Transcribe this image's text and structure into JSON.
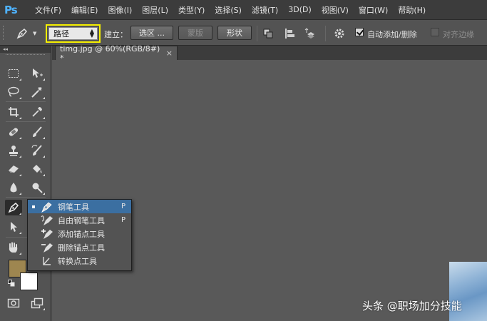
{
  "app": {
    "logo": "Ps"
  },
  "menubar": {
    "items": [
      "文件(F)",
      "编辑(E)",
      "图像(I)",
      "图层(L)",
      "类型(Y)",
      "选择(S)",
      "滤镜(T)",
      "3D(D)",
      "视图(V)",
      "窗口(W)",
      "帮助(H)"
    ]
  },
  "options": {
    "mode_value": "路径",
    "make_label": "建立：",
    "selection_button": "选区 ...",
    "mask_button": "蒙版",
    "shape_button": "形状",
    "auto_add_delete_label": "自动添加/删除",
    "auto_add_delete_checked": true,
    "align_edges_label": "对齐边缘",
    "align_edges_checked": false
  },
  "toolbar": {
    "collapse_arrows": "◂◂",
    "foreground_color": "#9e8650",
    "background_color": "#ffffff"
  },
  "document": {
    "tab_title": "timg.jpg @ 60%(RGB/8#) *",
    "close_glyph": "×"
  },
  "flyout": {
    "items": [
      {
        "label": "钢笔工具",
        "key": "P",
        "icon": "pen-icon",
        "selected": true
      },
      {
        "label": "自由钢笔工具",
        "key": "P",
        "icon": "freeform-pen-icon",
        "selected": false
      },
      {
        "label": "添加锚点工具",
        "key": "",
        "icon": "add-anchor-icon",
        "selected": false
      },
      {
        "label": "删除锚点工具",
        "key": "",
        "icon": "delete-anchor-icon",
        "selected": false
      },
      {
        "label": "转换点工具",
        "key": "",
        "icon": "convert-point-icon",
        "selected": false
      }
    ]
  },
  "watermark": "头条 @职场加分技能",
  "colors": {
    "highlight": "#f6f000",
    "selection": "#3b6fa1"
  }
}
